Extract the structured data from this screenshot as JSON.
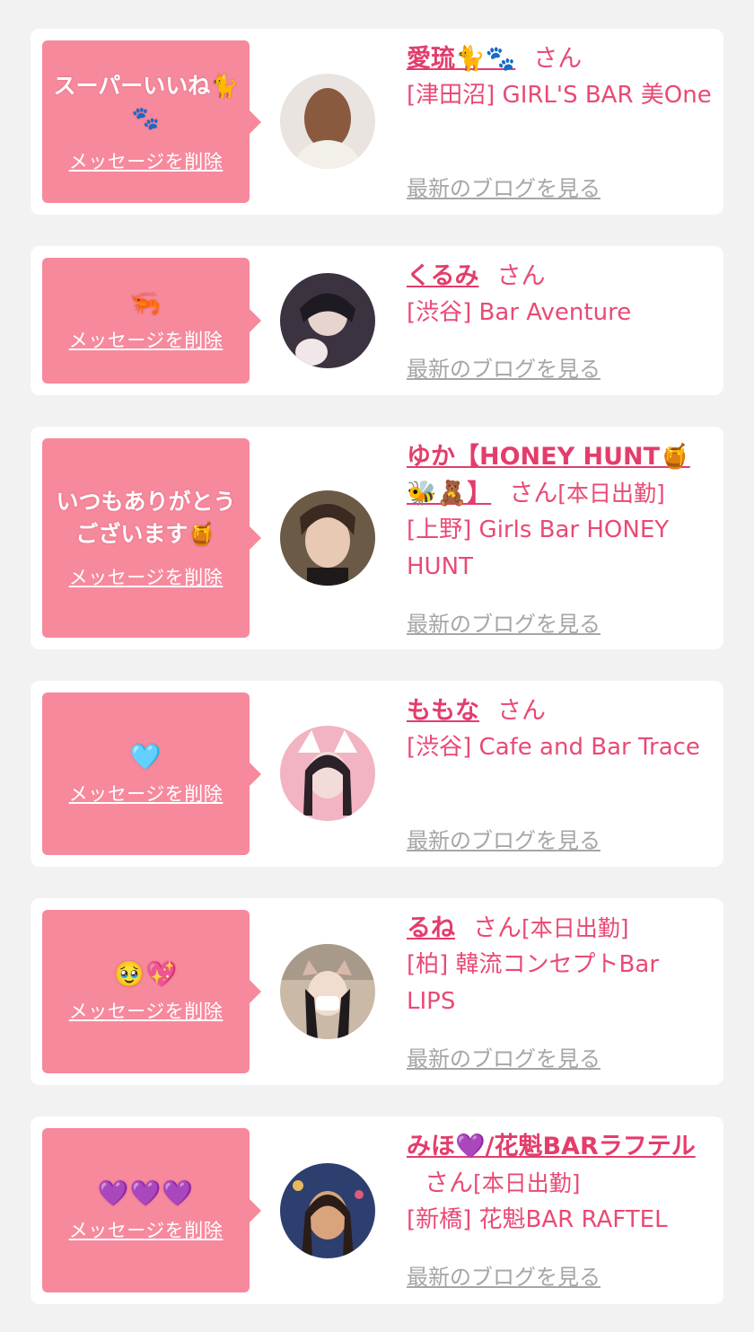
{
  "cards": [
    {
      "message": "スーパーいいね🐈\n🐾",
      "delete_label": "メッセージを削除",
      "name": "愛琉🐈🐾",
      "honorific": "さん",
      "attendance": "",
      "shop": "[津田沼] GIRL'S BAR 美One",
      "blog_label": "最新のブログを見る",
      "avatar_colors": [
        "#e9e4e0",
        "#8a5a3f"
      ]
    },
    {
      "message": "🦐",
      "delete_label": "メッセージを削除",
      "name": "くるみ",
      "honorific": "さん",
      "attendance": "",
      "shop": "[渋谷] Bar Aventure",
      "blog_label": "最新のブログを見る",
      "avatar_colors": [
        "#3b3340",
        "#f1e6e8"
      ]
    },
    {
      "message": "いつもありがとう\nございます🍯",
      "delete_label": "メッセージを削除",
      "name": "ゆか【HONEY HUNT🍯🐝🧸】",
      "honorific": "さん",
      "attendance": "[本日出勤]",
      "shop": "[上野] Girls Bar HONEY HUNT",
      "blog_label": "最新のブログを見る",
      "avatar_colors": [
        "#6b5a45",
        "#e8c9b4"
      ]
    },
    {
      "message": "🩵",
      "delete_label": "メッセージを削除",
      "name": "ももな",
      "honorific": "さん",
      "attendance": "",
      "shop": "[渋谷] Cafe and Bar Trace",
      "blog_label": "最新のブログを見る",
      "avatar_colors": [
        "#f2b3c2",
        "#2a2227"
      ]
    },
    {
      "message": "🥹💖",
      "delete_label": "メッセージを削除",
      "name": "るね",
      "honorific": "さん",
      "attendance": "[本日出勤]",
      "shop": "[柏] 韓流コンセプトBar LIPS",
      "blog_label": "最新のブログを見る",
      "avatar_colors": [
        "#c9b9a6",
        "#1f1b1c"
      ]
    },
    {
      "message": "💜💜💜",
      "delete_label": "メッセージを削除",
      "name": "みほ💜/花魁BARラフテル",
      "honorific": "さん",
      "attendance": "[本日出勤]",
      "shop": "[新橋] 花魁BAR RAFTEL",
      "blog_label": "最新のブログを見る",
      "avatar_colors": [
        "#2d3f6e",
        "#d9a37c"
      ]
    }
  ]
}
